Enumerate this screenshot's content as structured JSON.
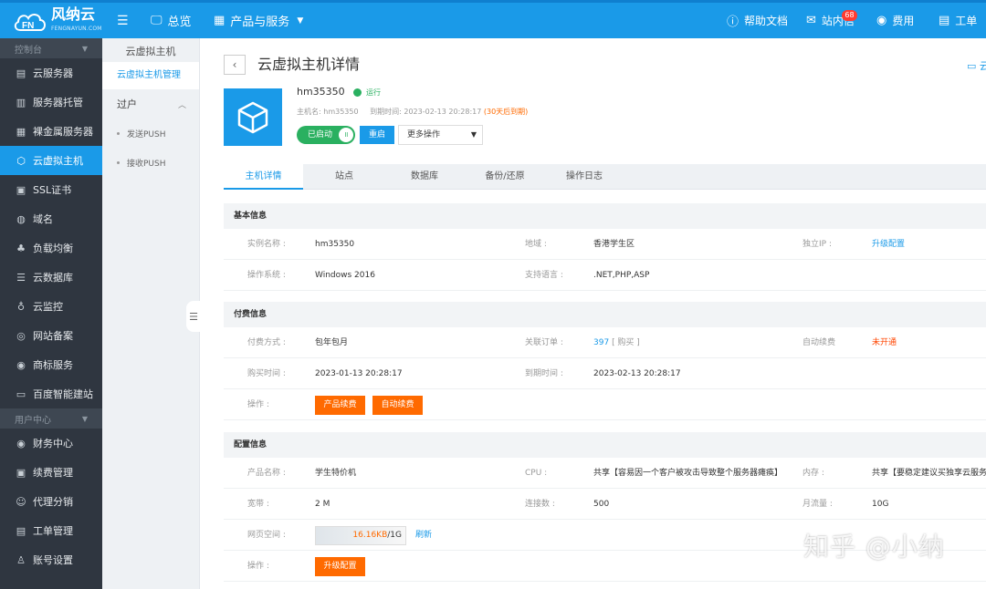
{
  "topbar": {
    "brand": "风纳云",
    "brand_sub": "FENGNAYUN.COM",
    "overview": "总览",
    "products": "产品与服务",
    "docs": "帮助文档",
    "inbox": "站内信",
    "inbox_badge": "68",
    "fee": "费用",
    "ticket": "工单",
    "accent": "#1a9ae8"
  },
  "sidebar": {
    "section_console": "控制台",
    "section_user": "用户中心",
    "items": [
      {
        "label": "云服务器",
        "icon": "server-list-icon"
      },
      {
        "label": "服务器托管",
        "icon": "hosting-icon"
      },
      {
        "label": "裸金属服务器",
        "icon": "bare-metal-icon"
      },
      {
        "label": "云虚拟主机",
        "icon": "cube-icon"
      },
      {
        "label": "SSL证书",
        "icon": "certificate-icon"
      },
      {
        "label": "域名",
        "icon": "globe-icon"
      },
      {
        "label": "负载均衡",
        "icon": "load-balancer-icon"
      },
      {
        "label": "云数据库",
        "icon": "database-icon"
      },
      {
        "label": "云监控",
        "icon": "monitor-icon"
      },
      {
        "label": "网站备案",
        "icon": "record-icon"
      },
      {
        "label": "商标服务",
        "icon": "trademark-icon"
      },
      {
        "label": "百度智能建站",
        "icon": "site-builder-icon"
      }
    ],
    "user_items": [
      {
        "label": "财务中心",
        "icon": "finance-icon"
      },
      {
        "label": "续费管理",
        "icon": "renew-icon"
      },
      {
        "label": "代理分销",
        "icon": "agent-icon"
      },
      {
        "label": "工单管理",
        "icon": "ticket-icon"
      },
      {
        "label": "账号设置",
        "icon": "account-icon"
      }
    ]
  },
  "subnav": {
    "title": "云虚拟主机",
    "active": "云虚拟主机管理",
    "group": "过户",
    "children": [
      "发送PUSH",
      "接收PUSH"
    ]
  },
  "header": {
    "title": "云虚拟主机详情",
    "corner_link": "云"
  },
  "host": {
    "name": "hm35350",
    "status": "运行",
    "meta_host_label": "主机名:",
    "meta_host_value": "hm35350",
    "meta_expire_label": "到期时间:",
    "meta_expire_value": "2023-02-13 20:28:17",
    "meta_expire_warn": "(30天后到期)",
    "toggle_label": "已启动",
    "restart": "重启",
    "more_ops": "更多操作"
  },
  "tabs": [
    "主机详情",
    "站点",
    "数据库",
    "备份/还原",
    "操作日志"
  ],
  "basic": {
    "title": "基本信息",
    "instance_label": "实例名称 :",
    "instance_value": "hm35350",
    "region_label": "地域 :",
    "region_value": "香港学生区",
    "ip_label": "独立IP :",
    "ip_value": "升级配置",
    "os_label": "操作系统 :",
    "os_value": "Windows 2016",
    "lang_label": "支持语言 :",
    "lang_value": ".NET,PHP,ASP"
  },
  "billing": {
    "title": "付费信息",
    "pay_label": "付费方式 :",
    "pay_value": "包年包月",
    "order_label": "关联订单 :",
    "order_value": "397",
    "order_extra": "[ 购买 ]",
    "auto_label": "自动续费",
    "auto_value": "未开通",
    "buy_label": "购买时间 :",
    "buy_value": "2023-01-13 20:28:17",
    "expire_label": "到期时间 :",
    "expire_value": "2023-02-13 20:28:17",
    "op_label": "操作 :",
    "renew_btn": "产品续费",
    "auto_btn": "自动续费"
  },
  "config": {
    "title": "配置信息",
    "product_label": "产品名称 :",
    "product_value": "学生特价机",
    "cpu_label": "CPU :",
    "cpu_value": "共享【容易因一个客户被攻击导致整个服务器瘫痪】",
    "mem_label": "内存 :",
    "mem_value": "共享【要稳定建议买独享云服务器】",
    "bw_label": "宽带 :",
    "bw_value": "2 M",
    "conn_label": "连接数 :",
    "conn_value": "500",
    "traffic_label": "月流量 :",
    "traffic_value": "10G",
    "space_label": "网页空间 :",
    "space_used": "16.16KB",
    "space_total": "/1G",
    "space_fraction": 1.54e-05,
    "refresh": "刷新",
    "op_label": "操作 :",
    "upgrade_btn": "升级配置"
  },
  "watermark": "知乎 @小纳"
}
